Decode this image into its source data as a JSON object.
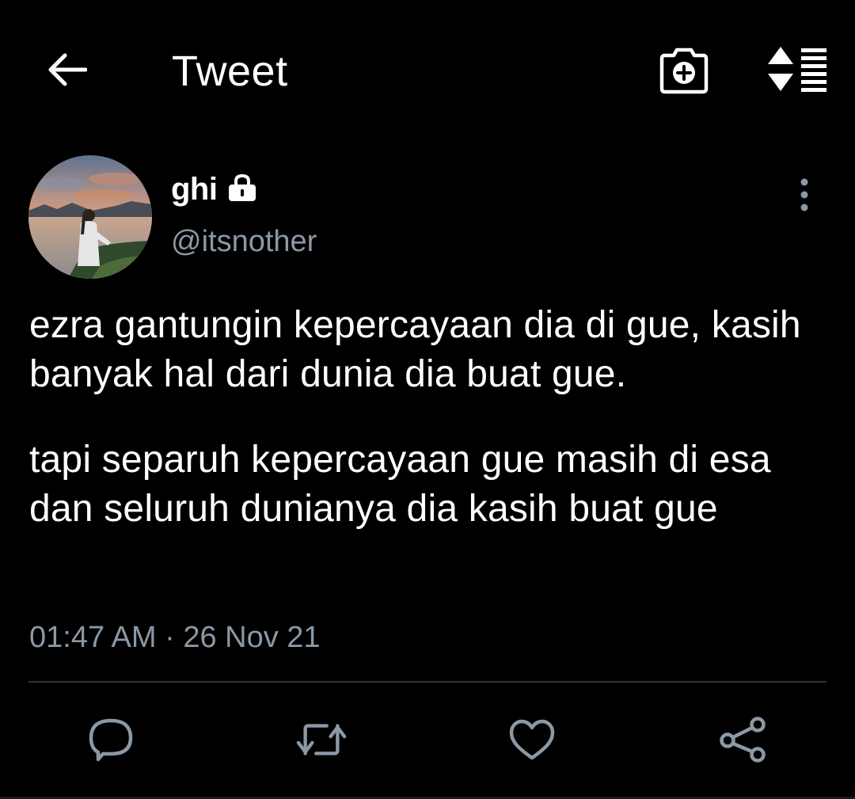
{
  "header": {
    "title": "Tweet",
    "back_icon": "arrow-left-icon",
    "camera_icon": "camera-add-icon",
    "sort_icon": "sort-list-icon"
  },
  "tweet": {
    "author": {
      "display_name": "ghi",
      "handle": "@itsnother",
      "protected_icon": "lock-icon"
    },
    "paragraphs": [
      "ezra gantungin kepercayaan dia di gue, kasih banyak hal dari dunia dia buat gue.",
      "tapi separuh kepercayaan gue masih di esa dan seluruh dunianya dia kasih buat gue"
    ],
    "timestamp": "01:47 AM · 26 Nov 21"
  },
  "actions": [
    "reply-icon",
    "retweet-icon",
    "like-icon",
    "share-icon"
  ],
  "colors": {
    "background": "#000000",
    "text": "#ffffff",
    "secondary_text": "#8b98a5",
    "divider": "#2f3336",
    "icon": "#8b98a5"
  }
}
